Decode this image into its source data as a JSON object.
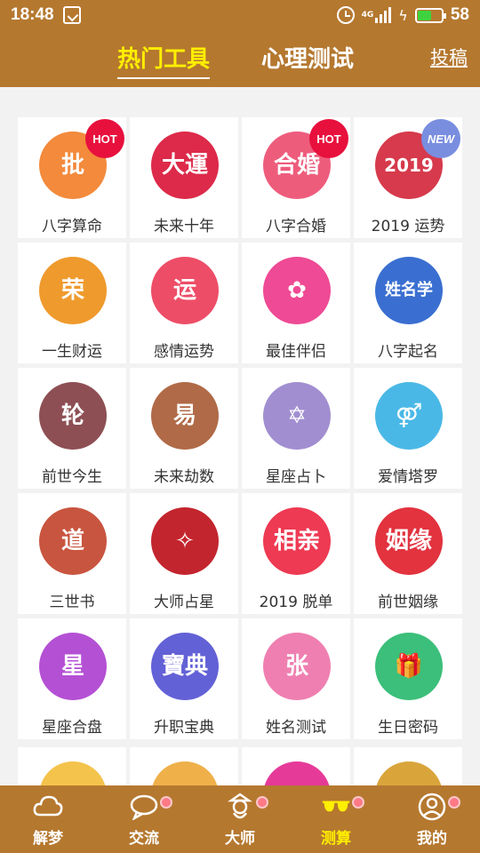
{
  "status": {
    "time": "18:48",
    "network": "4G",
    "battery": "58"
  },
  "header": {
    "tab_hot": "热门工具",
    "tab_psych": "心理测试",
    "submit": "投稿"
  },
  "tools": [
    {
      "label": "八字算命",
      "glyph": "批",
      "color": "#f38a3c",
      "badge": "HOT"
    },
    {
      "label": "未来十年",
      "glyph": "大運",
      "color": "#dd2a4a",
      "badge": ""
    },
    {
      "label": "八字合婚",
      "glyph": "合婚",
      "color": "#ee5c7c",
      "badge": "HOT"
    },
    {
      "label": "2019 运势",
      "glyph": "2019",
      "color": "#d63a4c",
      "badge": "NEW"
    },
    {
      "label": "一生财运",
      "glyph": "荣",
      "color": "#ef9a2d",
      "badge": ""
    },
    {
      "label": "感情运势",
      "glyph": "运",
      "color": "#ee4d67",
      "badge": ""
    },
    {
      "label": "最佳伴侣",
      "glyph": "✿",
      "color": "#ef4a95",
      "badge": ""
    },
    {
      "label": "八字起名",
      "glyph": "姓名学",
      "color": "#3a6fd1",
      "badge": ""
    },
    {
      "label": "前世今生",
      "glyph": "轮",
      "color": "#8d4f54",
      "badge": ""
    },
    {
      "label": "未来劫数",
      "glyph": "易",
      "color": "#b06a47",
      "badge": ""
    },
    {
      "label": "星座占卜",
      "glyph": "✡",
      "color": "#a18ed0",
      "badge": ""
    },
    {
      "label": "爱情塔罗",
      "glyph": "⚤",
      "color": "#4ab8e6",
      "badge": ""
    },
    {
      "label": "三世书",
      "glyph": "道",
      "color": "#c8553f",
      "badge": ""
    },
    {
      "label": "大师占星",
      "glyph": "✧",
      "color": "#c3252e",
      "badge": ""
    },
    {
      "label": "2019 脱单",
      "glyph": "相亲",
      "color": "#ee3a53",
      "badge": ""
    },
    {
      "label": "前世姻缘",
      "glyph": "姻缘",
      "color": "#e2333f",
      "badge": ""
    },
    {
      "label": "星座合盘",
      "glyph": "星",
      "color": "#b450d4",
      "badge": ""
    },
    {
      "label": "升职宝典",
      "glyph": "寶典",
      "color": "#6361d6",
      "badge": ""
    },
    {
      "label": "姓名测试",
      "glyph": "张",
      "color": "#ef7fb0",
      "badge": ""
    },
    {
      "label": "生日密码",
      "glyph": "🎁",
      "color": "#3bbf7a",
      "badge": ""
    }
  ],
  "partial_row_colors": [
    "#f4c34b",
    "#efb04a",
    "#e63a99",
    "#d9a53b"
  ],
  "nav": [
    {
      "label": "解梦",
      "icon": "cloud-icon",
      "dot": false,
      "active": false
    },
    {
      "label": "交流",
      "icon": "chat-icon",
      "dot": true,
      "active": false
    },
    {
      "label": "大师",
      "icon": "master-icon",
      "dot": true,
      "active": false
    },
    {
      "label": "测算",
      "icon": "glasses-icon",
      "dot": true,
      "active": true
    },
    {
      "label": "我的",
      "icon": "user-icon",
      "dot": true,
      "active": false
    }
  ]
}
